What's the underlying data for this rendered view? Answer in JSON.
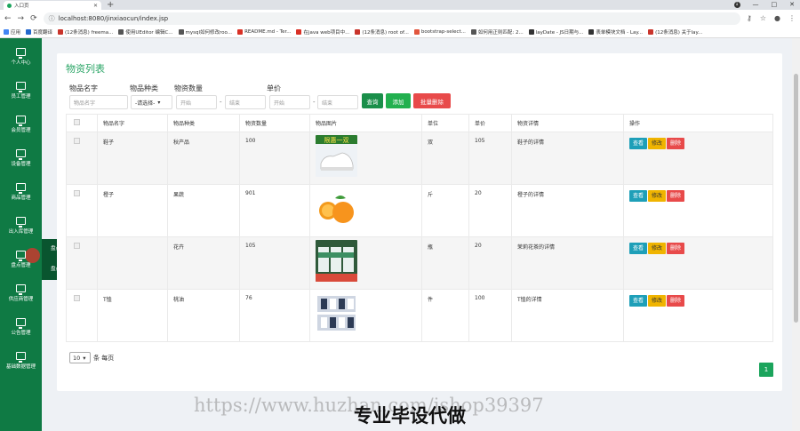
{
  "browser": {
    "tab_title": "入口页",
    "url": "localhost:8080/jinxiaocun/index.jsp",
    "bookmarks": [
      {
        "label": "应用",
        "color": "#4285f4"
      },
      {
        "label": "百度翻译",
        "color": "#2468cc"
      },
      {
        "label": "(12条消息) freema...",
        "color": "#c9342b"
      },
      {
        "label": "使用UEditor 编辑C...",
        "color": "#555555"
      },
      {
        "label": "mysql如何修改roo...",
        "color": "#555555"
      },
      {
        "label": "README.md - Ter...",
        "color": "#d93025"
      },
      {
        "label": "在java web项目中...",
        "color": "#d93025"
      },
      {
        "label": "(12条消息) root of...",
        "color": "#c9342b"
      },
      {
        "label": "bootstrap-select...",
        "color": "#e2563d"
      },
      {
        "label": "如何用正则匹配: 2...",
        "color": "#555555"
      },
      {
        "label": "layDate - JS日期与...",
        "color": "#333333"
      },
      {
        "label": "表单模块文档 - Lay...",
        "color": "#333333"
      },
      {
        "label": "(12条消息) 关于lay...",
        "color": "#c9342b"
      }
    ]
  },
  "sidebar": {
    "items": [
      {
        "label": "个人中心"
      },
      {
        "label": "员工管理"
      },
      {
        "label": "会员管理"
      },
      {
        "label": "设备管理"
      },
      {
        "label": "商品管理"
      },
      {
        "label": "出入库管理"
      },
      {
        "label": "盘点管理"
      },
      {
        "label": "供应商管理"
      },
      {
        "label": "公告管理"
      },
      {
        "label": "基础数据管理"
      }
    ],
    "submenu": [
      {
        "label": "盘点管理"
      },
      {
        "label": "盘点列表管理"
      }
    ]
  },
  "page": {
    "title": "物资列表"
  },
  "search": {
    "label_name": "物品名字",
    "label_type": "物品种类",
    "label_qty": "物资数量",
    "label_price": "单价",
    "placeholder_name": "物品名字",
    "select_type": "-请选择-",
    "qty_start": "开始",
    "qty_end": "结束",
    "price_start": "开始",
    "price_end": "结束",
    "dash": "-",
    "btn_query": "查询",
    "btn_add": "添加",
    "btn_batch_delete": "批量删除"
  },
  "table": {
    "headers": [
      "物品名字",
      "物品种类",
      "物资数量",
      "物品图片",
      "单位",
      "单价",
      "物资详情",
      "操作"
    ],
    "rows": [
      {
        "name": "鞋子",
        "type": "秋产品",
        "qty": "100",
        "image": "白色运动鞋",
        "image_caption": "限惠一双",
        "unit": "双",
        "price": "105",
        "detail": "鞋子的详情"
      },
      {
        "name": "橙子",
        "type": "果蔬",
        "qty": "901",
        "image": "橙子",
        "image_caption": "",
        "unit": "斤",
        "price": "20",
        "detail": "橙子的详情"
      },
      {
        "name": "",
        "type": "花卉",
        "qty": "105",
        "image": "茉莉花茶",
        "image_caption": "",
        "unit": "瓶",
        "price": "20",
        "detail": "茉莉花茶的详情"
      },
      {
        "name": "T恤",
        "type": "桃油",
        "qty": "76",
        "image": "T恤",
        "image_caption": "",
        "unit": "件",
        "price": "100",
        "detail": "T恤的详情"
      }
    ],
    "action_view": "查看",
    "action_edit": "修改",
    "action_delete": "删除"
  },
  "pagination": {
    "page_size": "10",
    "per_page_label": "条 每页",
    "current_page": "1"
  },
  "watermark": {
    "url_text": "https://www.huzhan.com/ishop39397",
    "overlay_text": "专业毕设代做"
  },
  "colors": {
    "sidebar": "#0f7a44",
    "submenu": "#09552f",
    "accent": "#1ba45c",
    "title": "#2aa566"
  }
}
